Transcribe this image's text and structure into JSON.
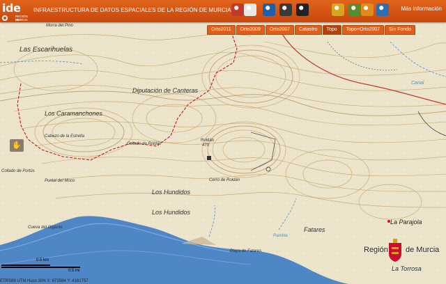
{
  "header": {
    "logo_text": "ide",
    "logo_sub1": "REGIÓN DE",
    "logo_sub2": "MURCIA",
    "title": "INFRAESTRUCTURA DE DATOS ESPACIALES DE LA REGIÓN DE MURCIA",
    "more_info": "Más información",
    "tools": [
      {
        "name": "book-icon",
        "color": "#c0392b"
      },
      {
        "name": "print-map-icon",
        "color": "#e8e8e8"
      },
      {
        "name": "info-icon",
        "color": "#1f5fa8"
      },
      {
        "name": "printer-icon",
        "color": "#3a3a3a"
      },
      {
        "name": "binoculars-icon",
        "color": "#222222"
      },
      {
        "name": "folder-icon",
        "color": "#d9a520"
      },
      {
        "name": "layers-add-icon",
        "color": "#5c8a2e"
      },
      {
        "name": "pencil-icon",
        "color": "#e38b1a"
      },
      {
        "name": "globe-icon",
        "color": "#2e6fb0"
      }
    ]
  },
  "layer_tabs": [
    {
      "label": "Orto2011",
      "active": false
    },
    {
      "label": "Orto2009",
      "active": false
    },
    {
      "label": "Orto2007",
      "active": false
    },
    {
      "label": "Catastro",
      "active": false
    },
    {
      "label": "Topo",
      "active": true
    },
    {
      "label": "Topo+Orto2007",
      "active": false
    },
    {
      "label": "Sin Fondo",
      "active": false
    }
  ],
  "map_labels": {
    "escarihuelas": "Las Escarihuelas",
    "morra": "Morra del Pino",
    "diputacion": "Diputación de Canteras",
    "caramanchones": "Los Caramanchones",
    "cabezo_estrella": "Cabezo de la Estrella",
    "collado": "Collado de Roldán",
    "roldan": "Roldán",
    "roldan_alt": "470",
    "cerro_roldan": "Cerro de Roldán",
    "hundidos1": "Los Hundidos",
    "hundidos2": "Los Hundidos",
    "puntal": "Puntal del Moco",
    "collado_portus": "Collado de Portús",
    "cueva": "Cueva del Gigante",
    "playa": "Playa de Fatares",
    "fatares": "Fatares",
    "parajola": "La Parajola",
    "torrosa": "La Torrosa",
    "canal": "Canal",
    "rambla": "Rambla"
  },
  "brand": {
    "text1": "Región",
    "text2": "de Murcia"
  },
  "scale": {
    "km": "0.5 km",
    "mi": "0.5 mi"
  },
  "coords": "ETRS89 UTM Huso 30N X: 673584  Y: 4161757",
  "colors": {
    "header": "#d2521a",
    "sea": "#4f86c6",
    "terrain": "#e9e1c8",
    "contour": "#c8a36a",
    "road": "#c8102e"
  }
}
